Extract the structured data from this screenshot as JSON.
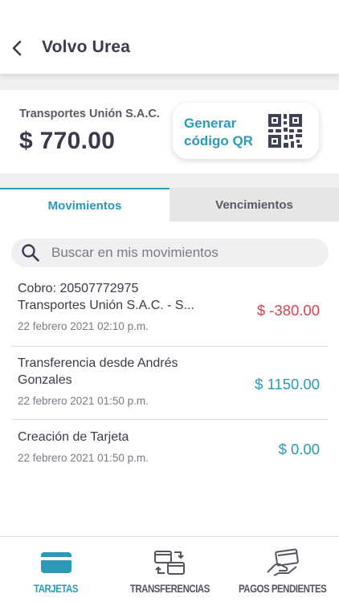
{
  "header": {
    "title": "Volvo Urea",
    "back_icon": "chevron-left-icon"
  },
  "card": {
    "company": "Transportes Unión S.A.C.",
    "amount": "$ 770.00",
    "qr_button": {
      "line1": "Generar",
      "line2": "código QR",
      "icon": "qr-code-icon"
    }
  },
  "tabs": [
    {
      "label": "Movimientos",
      "active": true
    },
    {
      "label": "Vencimientos",
      "active": false
    }
  ],
  "search": {
    "placeholder": "Buscar en mis movimientos",
    "value": "",
    "icon": "search-icon"
  },
  "transactions": [
    {
      "line1": "Cobro: 20507772975",
      "line2": "Transportes Unión S.A.C. - S...",
      "date": "22 febrero 2021 02:10 p.m.",
      "amount": "$ -380.00",
      "type": "debit"
    },
    {
      "line1": "Transferencia desde Andrés",
      "line2": "Gonzales",
      "date": "22 febrero 2021 01:50 p.m.",
      "amount": "$ 1150.00",
      "type": "credit"
    },
    {
      "line1": "Creación de Tarjeta",
      "line2": "",
      "date": "22 febrero 2021 01:50 p.m.",
      "amount": "$ 0.00",
      "type": "credit"
    }
  ],
  "bottom_nav": [
    {
      "label": "TARJETAS",
      "icon": "card-icon",
      "active": true
    },
    {
      "label": "TRANSFERENCIAS",
      "icon": "transfer-icon",
      "active": false
    },
    {
      "label": "PAGOS PENDIENTES",
      "icon": "payment-hand-icon",
      "active": false
    }
  ],
  "colors": {
    "accent": "#2a9ab8",
    "negative": "#d9414b",
    "text": "#3a3a4a",
    "muted": "#7a7a84",
    "band": "#eef0f1"
  }
}
